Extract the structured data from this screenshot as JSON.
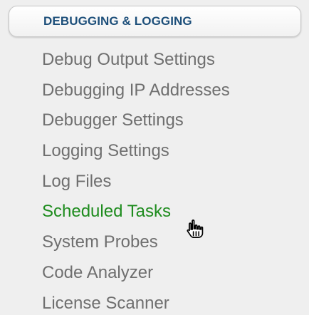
{
  "section": {
    "title": "DEBUGGING & LOGGING"
  },
  "menu": {
    "items": [
      {
        "label": "Debug Output Settings",
        "active": false
      },
      {
        "label": "Debugging IP Addresses",
        "active": false
      },
      {
        "label": "Debugger Settings",
        "active": false
      },
      {
        "label": "Logging Settings",
        "active": false
      },
      {
        "label": "Log Files",
        "active": false
      },
      {
        "label": "Scheduled Tasks",
        "active": true
      },
      {
        "label": "System Probes",
        "active": false
      },
      {
        "label": "Code Analyzer",
        "active": false
      },
      {
        "label": "License Scanner",
        "active": false
      }
    ]
  },
  "colors": {
    "header_text": "#1d4f7a",
    "item_text": "#6f6f6f",
    "active_item_text": "#1e8c1e",
    "background": "#efefef"
  },
  "cursor": {
    "icon": "hand-pointer-icon"
  }
}
